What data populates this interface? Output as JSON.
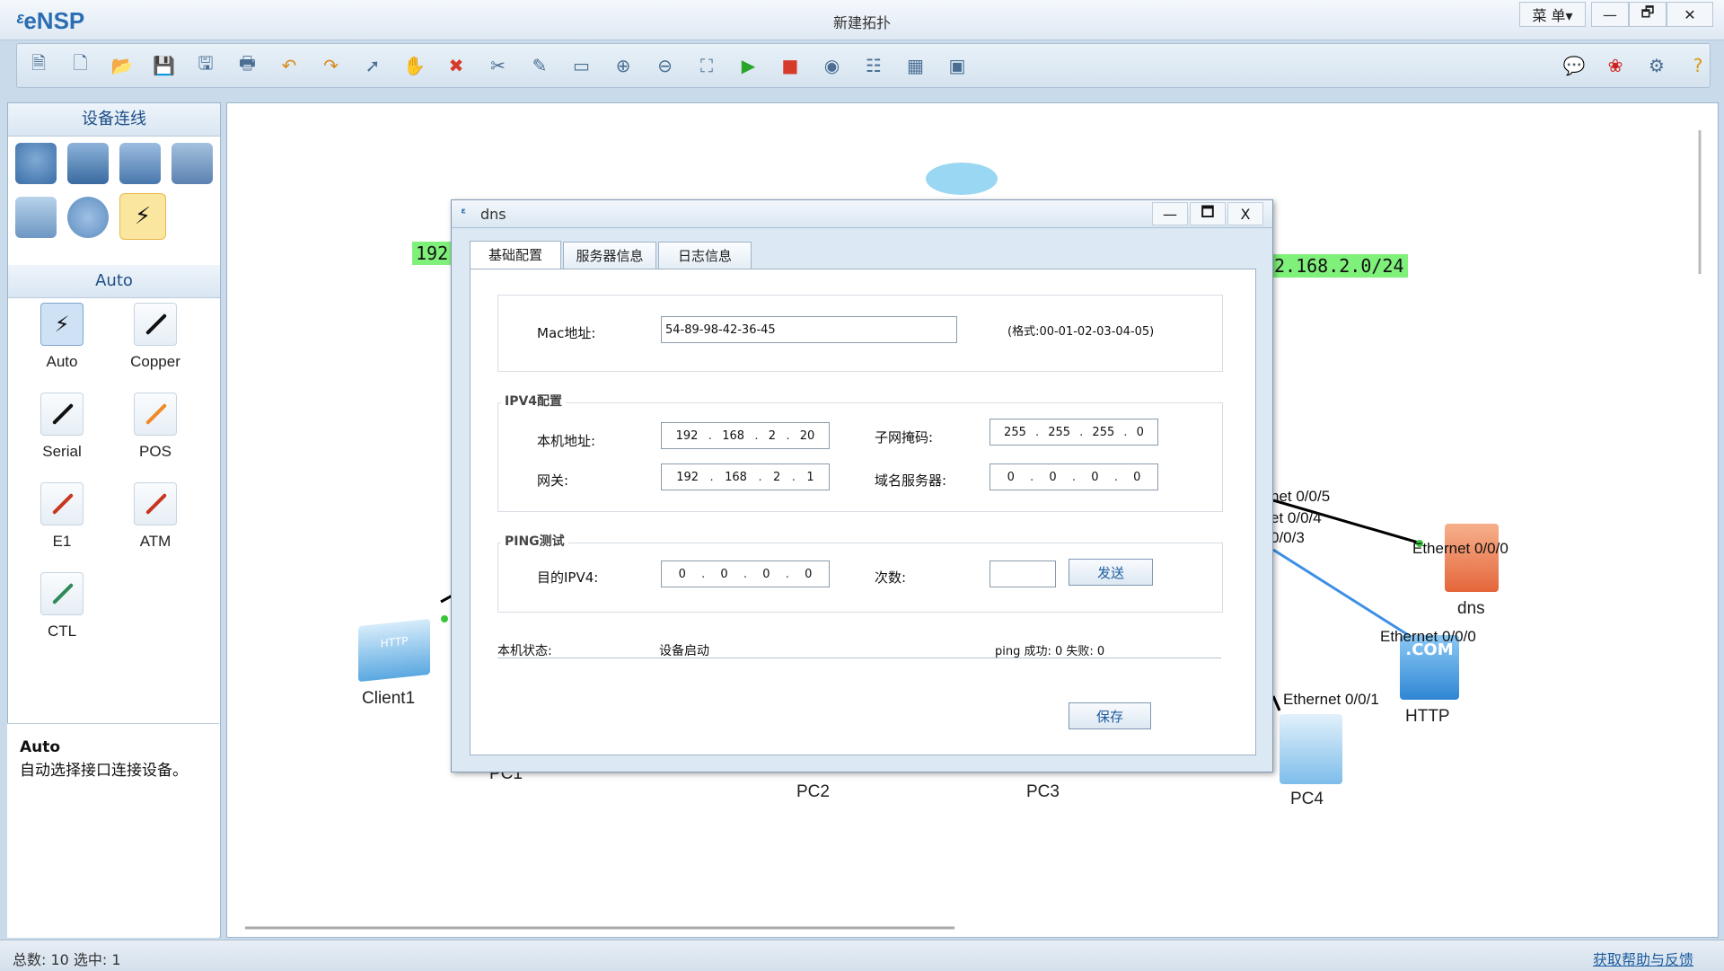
{
  "app": {
    "name": "eNSP",
    "window_title": "新建拓扑",
    "menu_label": "菜 单▾"
  },
  "window_controls": {
    "minimize": "—",
    "restore": "🗗",
    "close": "✕"
  },
  "toolbar": {
    "left_icons": [
      "new-topology-icon",
      "new-file-icon",
      "open-icon",
      "save-icon",
      "save-as-icon",
      "print-icon",
      "undo-icon",
      "redo-icon",
      "select-icon",
      "pan-hand-icon",
      "delete-icon",
      "delete-link-icon",
      "text-icon",
      "rectangle-icon",
      "zoom-in-icon",
      "zoom-out-icon",
      "fit-view-icon",
      "start-icon",
      "stop-icon",
      "capture-icon",
      "topology-icon",
      "table-icon",
      "terminal-icon"
    ],
    "right_icons": [
      "chat-icon",
      "huawei-icon",
      "settings-icon",
      "help-icon"
    ]
  },
  "left_panel": {
    "section1_title": "设备连线",
    "section2_title": "Auto",
    "links": [
      {
        "label": "Auto",
        "color": "#1a1a1a"
      },
      {
        "label": "Copper",
        "color": "#111111"
      },
      {
        "label": "Serial",
        "color": "#111111"
      },
      {
        "label": "POS",
        "color": "#f08a24"
      },
      {
        "label": "E1",
        "color": "#c8361e"
      },
      {
        "label": "ATM",
        "color": "#c8361e"
      },
      {
        "label": "CTL",
        "color": "#2e8b57"
      }
    ],
    "tip_title": "Auto",
    "tip_text": "自动选择接口连接设备。"
  },
  "canvas": {
    "tags": [
      "192",
      "2.168.2.0/24"
    ],
    "nodes": [
      "Client1",
      "PC1",
      "PC2",
      "PC3",
      "PC4",
      "dns",
      "HTTP"
    ],
    "ports": [
      "net 0/0/5",
      "et 0/0/4",
      "0/0/3",
      "Ethernet 0/0/0",
      "Ethernet 0/0/0",
      "Ethernet 0/0/1"
    ],
    "http_icon_text": "HTTP",
    "com_icon_text": ".COM"
  },
  "dialog": {
    "title": "dns",
    "tabs": [
      "基础配置",
      "服务器信息",
      "日志信息"
    ],
    "mac_label": "Mac地址:",
    "mac_value": "54-89-98-42-36-45",
    "mac_format": "(格式:00-01-02-03-04-05)",
    "ipv4_group": "IPV4配置",
    "ip_label": "本机地址:",
    "ip": [
      "192",
      "168",
      "2",
      "20"
    ],
    "mask_label": "子网掩码:",
    "mask": [
      "255",
      "255",
      "255",
      "0"
    ],
    "gw_label": "网关:",
    "gw": [
      "192",
      "168",
      "2",
      "1"
    ],
    "dns_label": "域名服务器:",
    "dns": [
      "0",
      "0",
      "0",
      "0"
    ],
    "ping_group": "PING测试",
    "dst_label": "目的IPV4:",
    "dst": [
      "0",
      "0",
      "0",
      "0"
    ],
    "count_label": "次数:",
    "count_value": "",
    "send_button": "发送",
    "status_label": "本机状态:",
    "status_value": "设备启动",
    "ping_result": "ping 成功: 0  失败: 0",
    "save_button": "保存",
    "ctl_min": "—",
    "ctl_max": "🗖",
    "ctl_close": "X"
  },
  "statusbar": {
    "left": "总数: 10  选中: 1",
    "right": "获取帮助与反馈"
  }
}
